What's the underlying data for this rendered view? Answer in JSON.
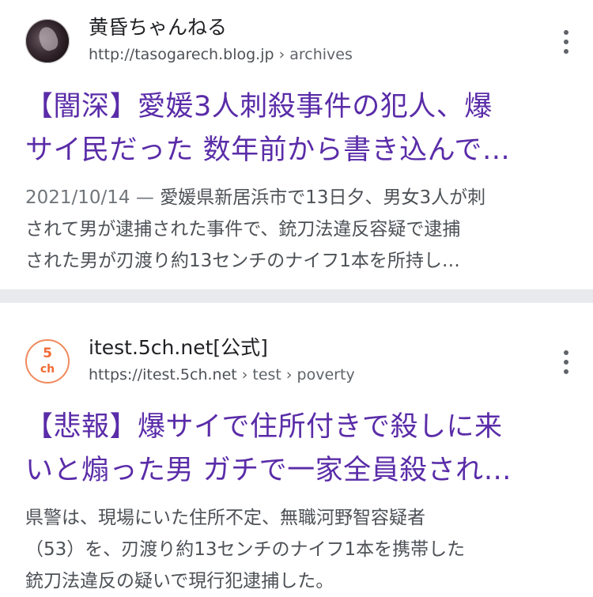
{
  "results": [
    {
      "site_name": "黄昏ちゃんねる",
      "url_base": "http://tasogarech.blog.jp",
      "url_crumbs": " › archives",
      "title_lines": [
        "【闇深】愛媛3人刺殺事件の犯人、爆",
        "サイ民だった 数年前から書き込んで…"
      ],
      "date": "2021/10/14 — ",
      "snippet_first": "愛媛県新居浜市で13日夕、男女3人が刺",
      "snippet_lines": [
        "されて男が逮捕された事件で、銃刀法違反容疑で逮捕",
        "された男が刃渡り約13センチのナイフ1本を所持し…"
      ]
    },
    {
      "site_name": "itest.5ch.net[公式]",
      "url_base": "https://itest.5ch.net",
      "url_crumbs": " › test › poverty",
      "favicon_text_top": "5",
      "favicon_text_bottom": "ch",
      "title_lines": [
        "【悲報】爆サイで住所付きで殺しに来",
        "いと煽った男 ガチで一家全員殺され…"
      ],
      "snippet_lines": [
        "県警は、現場にいた住所不定、無職河野智容疑者",
        "（53）を、刃渡り約13センチのナイフ1本を携帯した",
        "銃刀法違反の疑いで現行犯逮捕した。"
      ]
    }
  ]
}
